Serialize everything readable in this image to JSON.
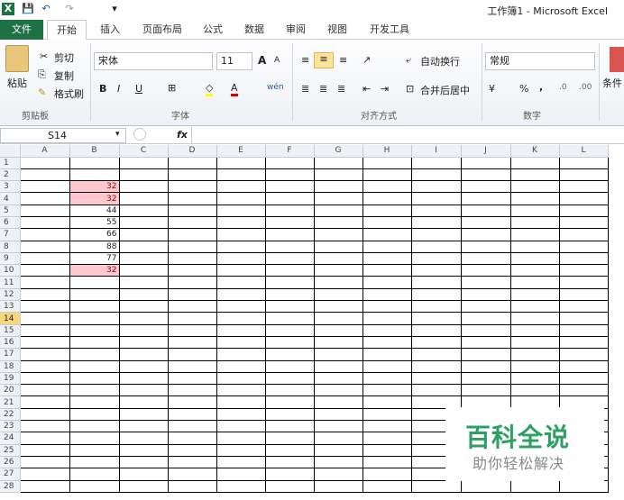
{
  "window": {
    "title": "工作簿1 - Microsoft Excel"
  },
  "quick_access": {
    "excel_icon": "X",
    "save": "💾",
    "undo": "↶",
    "redo": "↷",
    "customize": "▾"
  },
  "tabs": {
    "file": "文件",
    "home": "开始",
    "insert": "插入",
    "page_layout": "页面布局",
    "formulas": "公式",
    "data": "数据",
    "review": "审阅",
    "view": "视图",
    "developer": "开发工具"
  },
  "clipboard": {
    "paste": "粘贴",
    "cut": "剪切",
    "copy": "复制",
    "format_painter": "格式刷",
    "group": "剪贴板"
  },
  "font": {
    "name": "宋体",
    "size": "11",
    "bold": "B",
    "italic": "I",
    "underline": "U",
    "grow": "A",
    "shrink": "A",
    "wen": "wén",
    "group": "字体"
  },
  "alignment": {
    "wrap": "自动换行",
    "merge": "合并后居中",
    "group": "对齐方式"
  },
  "number": {
    "format": "常规",
    "percent": "%",
    "comma": ",",
    "group": "数字"
  },
  "styles": {
    "conditional": "条件"
  },
  "formula_bar": {
    "name_box": "S14",
    "fx": "fx",
    "formula": ""
  },
  "columns": [
    "A",
    "B",
    "C",
    "D",
    "E",
    "F",
    "G",
    "H",
    "I",
    "J",
    "K",
    "L"
  ],
  "rows": [
    "1",
    "2",
    "3",
    "4",
    "5",
    "6",
    "7",
    "8",
    "9",
    "10",
    "11",
    "12",
    "13",
    "14",
    "15",
    "16",
    "17",
    "18",
    "19",
    "20",
    "21",
    "22",
    "23",
    "24",
    "25",
    "26",
    "27",
    "28"
  ],
  "b_values": {
    "3": "32",
    "4": "32",
    "5": "44",
    "6": "55",
    "7": "66",
    "8": "88",
    "9": "77",
    "10": "32"
  },
  "duplicate_rows": [
    "3",
    "4",
    "10"
  ],
  "selected_row": "14",
  "colors": {
    "excel_green": "#1e7145",
    "duplicate_fill": "#ffc7ce",
    "duplicate_text": "#9c0006",
    "selected_header": "#f8d67a"
  },
  "watermark": {
    "line1": "百科全说",
    "line2": "助你轻松解决"
  }
}
